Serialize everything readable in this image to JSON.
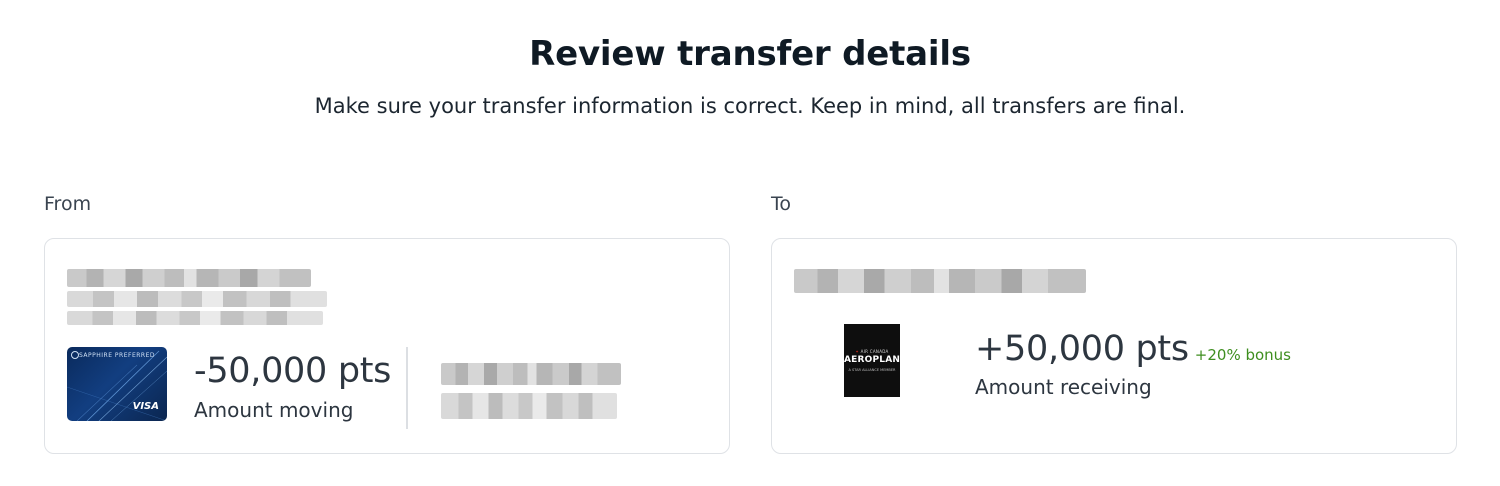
{
  "header": {
    "title": "Review transfer details",
    "subtitle": "Make sure your transfer information is correct. Keep in mind, all transfers are final."
  },
  "from": {
    "label": "From",
    "card": {
      "brand_text": "SAPPHIRE PREFERRED",
      "network": "VISA"
    },
    "amount": "-50,000 pts",
    "amount_caption": "Amount moving"
  },
  "to": {
    "label": "To",
    "partner_logo": {
      "top_text": "AIR CANADA",
      "name": "AEROPLAN",
      "bottom_text": "A STAR ALLIANCE MEMBER"
    },
    "amount": "+50,000 pts",
    "bonus": "+20% bonus",
    "amount_caption": "Amount receiving"
  },
  "colors": {
    "bonus_green": "#3e8e1f",
    "card_blue": "#123e80",
    "panel_border": "#dfe2e6"
  }
}
